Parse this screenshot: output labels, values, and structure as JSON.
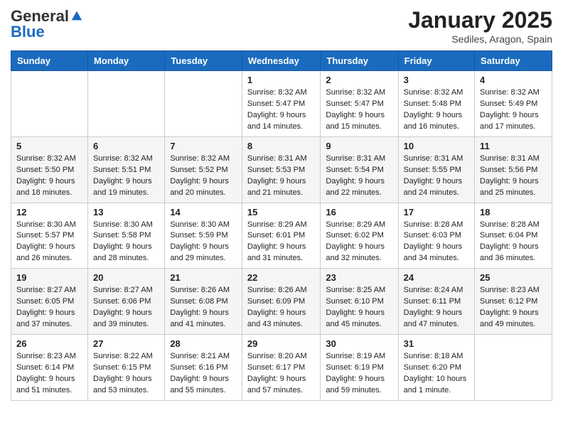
{
  "logo": {
    "general": "General",
    "blue": "Blue"
  },
  "header": {
    "month": "January 2025",
    "location": "Sediles, Aragon, Spain"
  },
  "days_of_week": [
    "Sunday",
    "Monday",
    "Tuesday",
    "Wednesday",
    "Thursday",
    "Friday",
    "Saturday"
  ],
  "weeks": [
    [
      {
        "day": "",
        "info": ""
      },
      {
        "day": "",
        "info": ""
      },
      {
        "day": "",
        "info": ""
      },
      {
        "day": "1",
        "info": "Sunrise: 8:32 AM\nSunset: 5:47 PM\nDaylight: 9 hours\nand 14 minutes."
      },
      {
        "day": "2",
        "info": "Sunrise: 8:32 AM\nSunset: 5:47 PM\nDaylight: 9 hours\nand 15 minutes."
      },
      {
        "day": "3",
        "info": "Sunrise: 8:32 AM\nSunset: 5:48 PM\nDaylight: 9 hours\nand 16 minutes."
      },
      {
        "day": "4",
        "info": "Sunrise: 8:32 AM\nSunset: 5:49 PM\nDaylight: 9 hours\nand 17 minutes."
      }
    ],
    [
      {
        "day": "5",
        "info": "Sunrise: 8:32 AM\nSunset: 5:50 PM\nDaylight: 9 hours\nand 18 minutes."
      },
      {
        "day": "6",
        "info": "Sunrise: 8:32 AM\nSunset: 5:51 PM\nDaylight: 9 hours\nand 19 minutes."
      },
      {
        "day": "7",
        "info": "Sunrise: 8:32 AM\nSunset: 5:52 PM\nDaylight: 9 hours\nand 20 minutes."
      },
      {
        "day": "8",
        "info": "Sunrise: 8:31 AM\nSunset: 5:53 PM\nDaylight: 9 hours\nand 21 minutes."
      },
      {
        "day": "9",
        "info": "Sunrise: 8:31 AM\nSunset: 5:54 PM\nDaylight: 9 hours\nand 22 minutes."
      },
      {
        "day": "10",
        "info": "Sunrise: 8:31 AM\nSunset: 5:55 PM\nDaylight: 9 hours\nand 24 minutes."
      },
      {
        "day": "11",
        "info": "Sunrise: 8:31 AM\nSunset: 5:56 PM\nDaylight: 9 hours\nand 25 minutes."
      }
    ],
    [
      {
        "day": "12",
        "info": "Sunrise: 8:30 AM\nSunset: 5:57 PM\nDaylight: 9 hours\nand 26 minutes."
      },
      {
        "day": "13",
        "info": "Sunrise: 8:30 AM\nSunset: 5:58 PM\nDaylight: 9 hours\nand 28 minutes."
      },
      {
        "day": "14",
        "info": "Sunrise: 8:30 AM\nSunset: 5:59 PM\nDaylight: 9 hours\nand 29 minutes."
      },
      {
        "day": "15",
        "info": "Sunrise: 8:29 AM\nSunset: 6:01 PM\nDaylight: 9 hours\nand 31 minutes."
      },
      {
        "day": "16",
        "info": "Sunrise: 8:29 AM\nSunset: 6:02 PM\nDaylight: 9 hours\nand 32 minutes."
      },
      {
        "day": "17",
        "info": "Sunrise: 8:28 AM\nSunset: 6:03 PM\nDaylight: 9 hours\nand 34 minutes."
      },
      {
        "day": "18",
        "info": "Sunrise: 8:28 AM\nSunset: 6:04 PM\nDaylight: 9 hours\nand 36 minutes."
      }
    ],
    [
      {
        "day": "19",
        "info": "Sunrise: 8:27 AM\nSunset: 6:05 PM\nDaylight: 9 hours\nand 37 minutes."
      },
      {
        "day": "20",
        "info": "Sunrise: 8:27 AM\nSunset: 6:06 PM\nDaylight: 9 hours\nand 39 minutes."
      },
      {
        "day": "21",
        "info": "Sunrise: 8:26 AM\nSunset: 6:08 PM\nDaylight: 9 hours\nand 41 minutes."
      },
      {
        "day": "22",
        "info": "Sunrise: 8:26 AM\nSunset: 6:09 PM\nDaylight: 9 hours\nand 43 minutes."
      },
      {
        "day": "23",
        "info": "Sunrise: 8:25 AM\nSunset: 6:10 PM\nDaylight: 9 hours\nand 45 minutes."
      },
      {
        "day": "24",
        "info": "Sunrise: 8:24 AM\nSunset: 6:11 PM\nDaylight: 9 hours\nand 47 minutes."
      },
      {
        "day": "25",
        "info": "Sunrise: 8:23 AM\nSunset: 6:12 PM\nDaylight: 9 hours\nand 49 minutes."
      }
    ],
    [
      {
        "day": "26",
        "info": "Sunrise: 8:23 AM\nSunset: 6:14 PM\nDaylight: 9 hours\nand 51 minutes."
      },
      {
        "day": "27",
        "info": "Sunrise: 8:22 AM\nSunset: 6:15 PM\nDaylight: 9 hours\nand 53 minutes."
      },
      {
        "day": "28",
        "info": "Sunrise: 8:21 AM\nSunset: 6:16 PM\nDaylight: 9 hours\nand 55 minutes."
      },
      {
        "day": "29",
        "info": "Sunrise: 8:20 AM\nSunset: 6:17 PM\nDaylight: 9 hours\nand 57 minutes."
      },
      {
        "day": "30",
        "info": "Sunrise: 8:19 AM\nSunset: 6:19 PM\nDaylight: 9 hours\nand 59 minutes."
      },
      {
        "day": "31",
        "info": "Sunrise: 8:18 AM\nSunset: 6:20 PM\nDaylight: 10 hours\nand 1 minute."
      },
      {
        "day": "",
        "info": ""
      }
    ]
  ]
}
